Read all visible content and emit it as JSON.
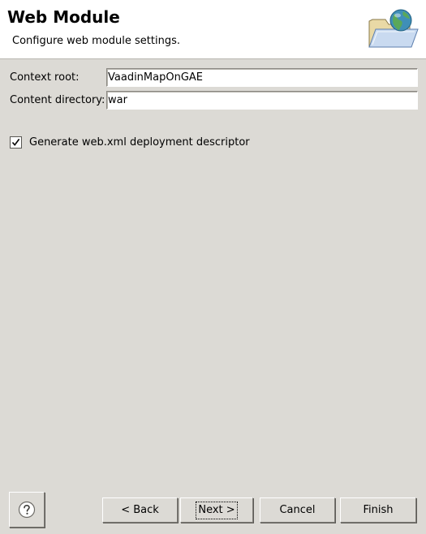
{
  "header": {
    "title": "Web Module",
    "description": "Configure web module settings.",
    "banner_icon": "web-folder-globe-icon"
  },
  "form": {
    "context_root": {
      "label": "Context root:",
      "value": "VaadinMapOnGAE"
    },
    "content_directory": {
      "label": "Content directory:",
      "value": "war"
    },
    "generate_descriptor": {
      "label": "Generate web.xml deployment descriptor",
      "checked": true
    }
  },
  "buttons": {
    "help_icon": "help-icon",
    "back": "< Back",
    "next": "Next >",
    "cancel": "Cancel",
    "finish": "Finish"
  },
  "colors": {
    "dialog_background": "#dcdad5",
    "header_background": "#ffffff"
  }
}
